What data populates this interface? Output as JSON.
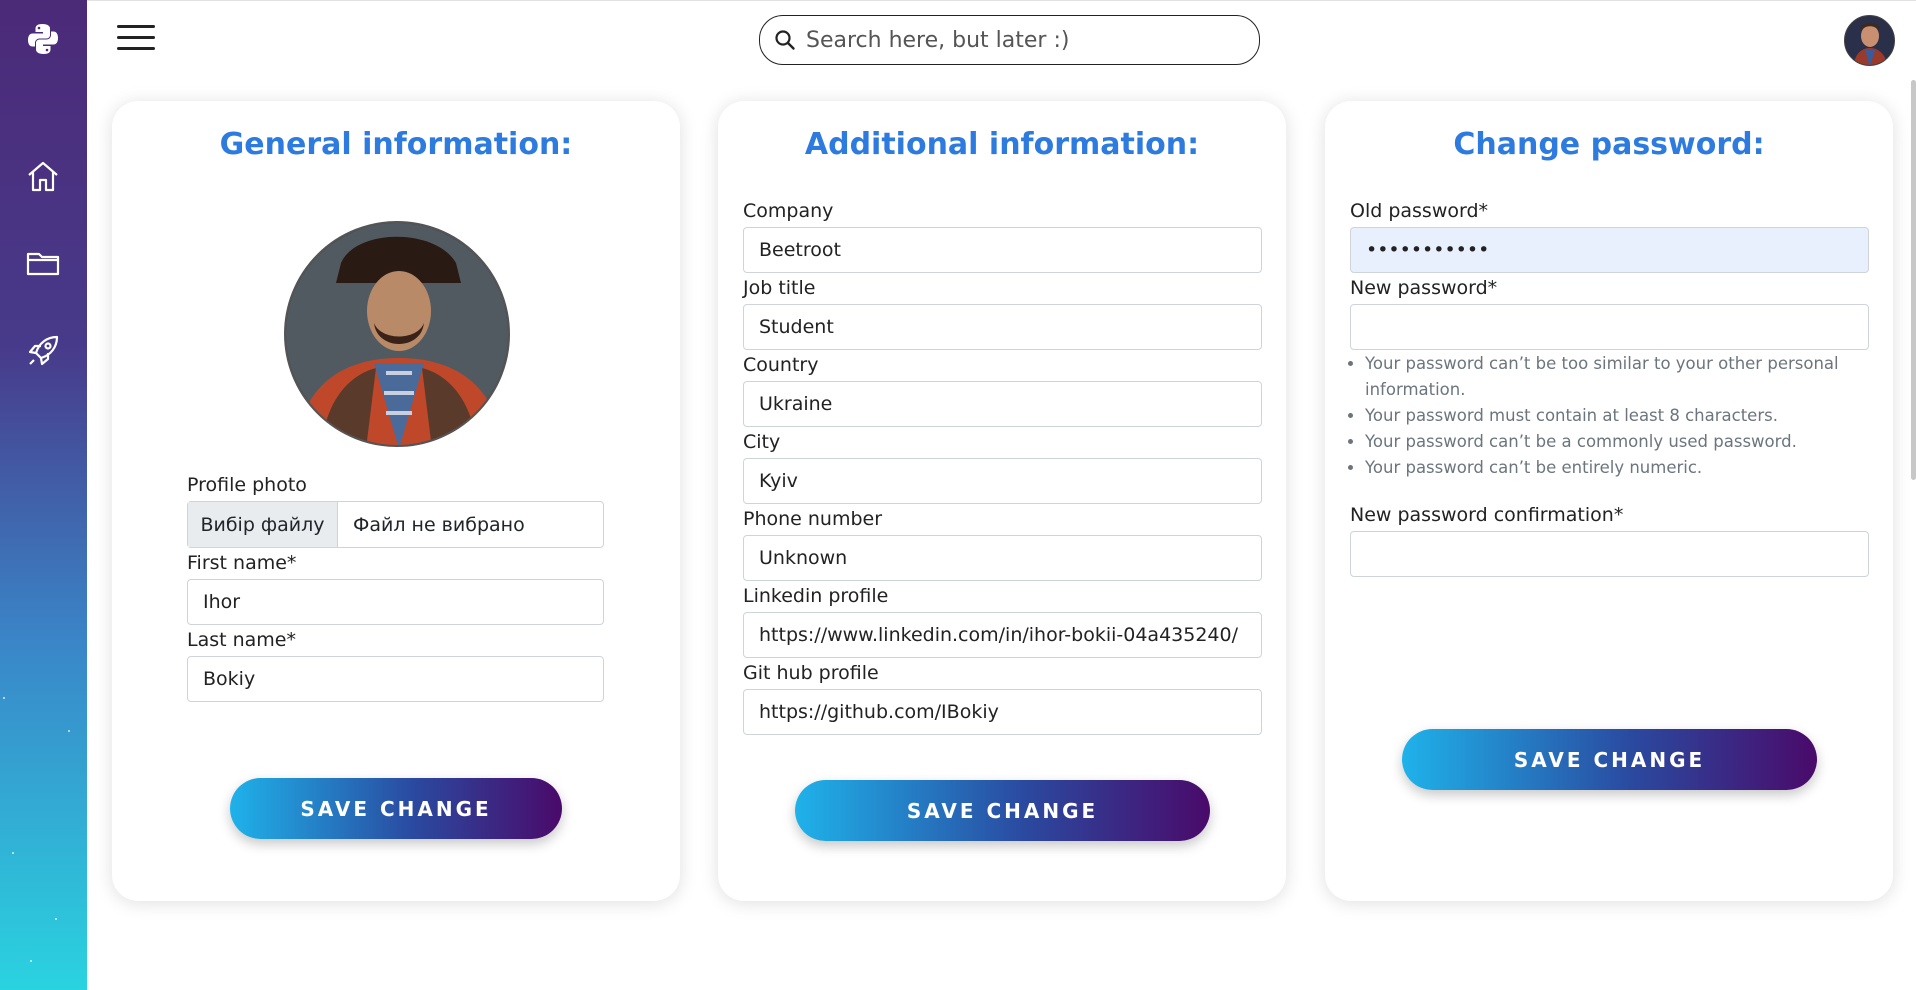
{
  "search": {
    "placeholder": "Search here, but later :)"
  },
  "cards": {
    "general": {
      "title": "General information:",
      "profile_photo_label": "Profile photo",
      "file_button": "Вибір файлу",
      "file_status": "Файл не вибрано",
      "first_name_label": "First name*",
      "first_name_value": "Ihor",
      "last_name_label": "Last name*",
      "last_name_value": "Bokiy",
      "save_label": "SAVE CHANGE"
    },
    "additional": {
      "title": "Additional information:",
      "company_label": "Company",
      "company_value": "Beetroot",
      "job_label": "Job title",
      "job_value": "Student",
      "country_label": "Country",
      "country_value": "Ukraine",
      "city_label": "City",
      "city_value": "Kyiv",
      "phone_label": "Phone number",
      "phone_value": "Unknown",
      "linkedin_label": "Linkedin profile",
      "linkedin_value": "https://www.linkedin.com/in/ihor-bokii-04a435240/",
      "github_label": "Git hub profile",
      "github_value": "https://github.com/IBokiy",
      "save_label": "SAVE CHANGE"
    },
    "password": {
      "title": "Change password:",
      "old_label": "Old password*",
      "old_value": "•••••••••••",
      "new_label": "New password*",
      "hints": [
        "Your password can’t be too similar to your other personal information.",
        "Your password must contain at least 8 characters.",
        "Your password can’t be a commonly used password.",
        "Your password can’t be entirely numeric."
      ],
      "confirm_label": "New password confirmation*",
      "save_label": "SAVE CHANGE"
    }
  },
  "sidebar": {
    "items": [
      {
        "icon": "python-logo-icon"
      },
      {
        "icon": "home-icon"
      },
      {
        "icon": "folder-icon"
      },
      {
        "icon": "rocket-icon"
      }
    ]
  },
  "colors": {
    "accent": "#2e7be0",
    "button_gradient_start": "#1fb2ea",
    "button_gradient_end": "#4a0a6a"
  }
}
